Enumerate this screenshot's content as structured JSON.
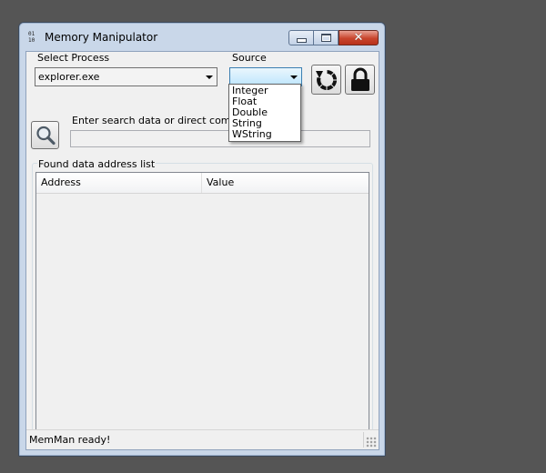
{
  "window": {
    "title": "Memory Manipulator",
    "app_icon_text": "01\n10",
    "close_glyph": "✕"
  },
  "process": {
    "label": "Select Process",
    "selected": "explorer.exe"
  },
  "source": {
    "label": "Source",
    "selected": "",
    "options": [
      "Integer",
      "Float",
      "Double",
      "String",
      "WString"
    ]
  },
  "search": {
    "label": "Enter search data or direct comma",
    "value": ""
  },
  "results": {
    "group_label": "Found data address list",
    "columns": [
      "Address",
      "Value"
    ],
    "rows": []
  },
  "status": {
    "text": "MemMan ready!"
  },
  "icons": {
    "search": "magnifier-icon",
    "refresh": "refresh-icon",
    "lock": "lock-icon"
  }
}
